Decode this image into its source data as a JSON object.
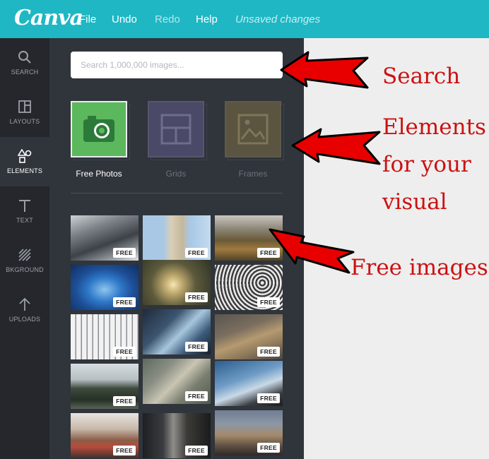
{
  "app": {
    "logo": "Canva",
    "menu": [
      "File",
      "Undo",
      "Redo",
      "Help"
    ],
    "status": "Unsaved changes"
  },
  "sidebar": {
    "items": [
      {
        "label": "SEARCH",
        "icon": "search-icon"
      },
      {
        "label": "LAYOUTS",
        "icon": "layouts-icon"
      },
      {
        "label": "ELEMENTS",
        "icon": "elements-icon"
      },
      {
        "label": "TEXT",
        "icon": "text-icon"
      },
      {
        "label": "BKGROUND",
        "icon": "background-icon"
      },
      {
        "label": "UPLOADS",
        "icon": "uploads-icon"
      }
    ],
    "active": "ELEMENTS"
  },
  "panel": {
    "search_placeholder": "Search 1,000,000 images...",
    "categories": [
      {
        "label": "Free Photos",
        "icon": "camera-icon",
        "color": "#5cb85c",
        "active": true
      },
      {
        "label": "Grids",
        "icon": "grid-icon",
        "color": "#4a4968",
        "active": false
      },
      {
        "label": "Frames",
        "icon": "frame-icon",
        "color": "#5a5440",
        "active": false
      }
    ],
    "photos": [
      {
        "subject": "typewriter",
        "badge": "FREE"
      },
      {
        "subject": "leaning tower",
        "badge": "FREE"
      },
      {
        "subject": "mountain landscape",
        "badge": "FREE"
      },
      {
        "subject": "underwater",
        "badge": "FREE"
      },
      {
        "subject": "forest sunlight",
        "badge": "FREE"
      },
      {
        "subject": "spiral architecture",
        "badge": "FREE"
      },
      {
        "subject": "building facade",
        "badge": "FREE"
      },
      {
        "subject": "earth from space",
        "badge": "FREE"
      },
      {
        "subject": "wrapped gifts",
        "badge": "FREE"
      },
      {
        "subject": "forest road",
        "badge": "FREE"
      },
      {
        "subject": "highway aerial",
        "badge": "FREE"
      },
      {
        "subject": "airplane wing",
        "badge": "FREE"
      },
      {
        "subject": "cafe interior",
        "badge": "FREE"
      },
      {
        "subject": "window room",
        "badge": "FREE"
      },
      {
        "subject": "city skyline",
        "badge": "FREE"
      }
    ]
  },
  "annotations": {
    "search": "Search",
    "elements_line1": "Elements",
    "elements_line2": "for your",
    "elements_line3": "visual",
    "free_images": "Free images"
  },
  "colors": {
    "topbar": "#1fb7c4",
    "rail": "#25272c",
    "panel": "#30343b",
    "annotation": "#cc1111"
  }
}
